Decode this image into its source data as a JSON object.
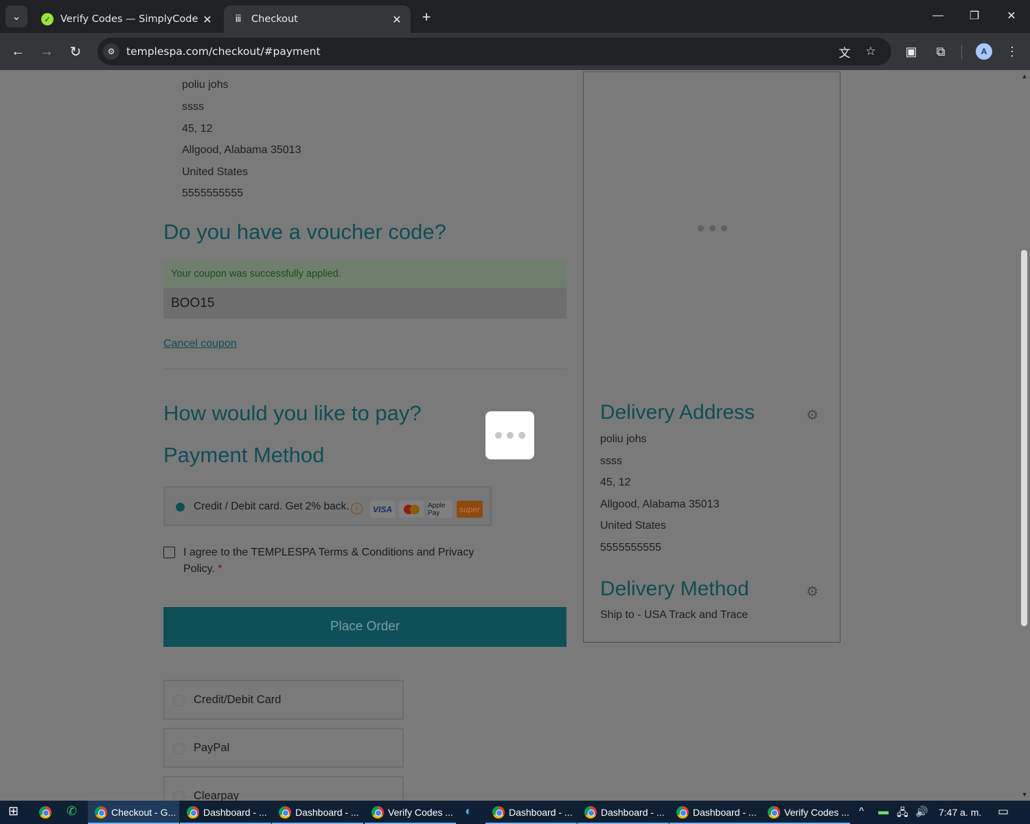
{
  "browser": {
    "tabs": [
      {
        "label": "Verify Codes — SimplyCodes",
        "active": false,
        "icon": "simplycodes-icon"
      },
      {
        "label": "Checkout",
        "active": true,
        "icon": "templespa-icon"
      }
    ],
    "url": "templespa.com/checkout/#payment",
    "profile_initial": "A"
  },
  "billing_address": [
    "poliu johs",
    "ssss",
    "45, 12",
    "Allgood, Alabama 35013",
    "United States",
    "5555555555"
  ],
  "voucher": {
    "heading": "Do you have a voucher code?",
    "success_message": "Your coupon was successfully applied.",
    "code_value": "BOO15",
    "cancel_link": "Cancel coupon"
  },
  "payment": {
    "heading": "How would you like to pay?",
    "method_heading": "Payment Method",
    "selected_option": "Credit / Debit card. Get 2% back.",
    "card_logos": [
      "VISA",
      "mastercard",
      "Apple Pay",
      "super"
    ],
    "terms_text": "I agree to the TEMPLESPA Terms & Conditions and Privacy Policy.",
    "terms_required_mark": "*",
    "place_order": "Place Order",
    "alternative_options": [
      "Credit/Debit Card",
      "PayPal",
      "Clearpay"
    ]
  },
  "sidebar": {
    "delivery_address_heading": "Delivery Address",
    "delivery_address": [
      "poliu johs",
      "ssss",
      "45, 12",
      "Allgood, Alabama 35013",
      "United States",
      "5555555555"
    ],
    "delivery_method_heading": "Delivery Method",
    "delivery_method": "Ship to - USA Track and Trace"
  },
  "taskbar": {
    "apps": [
      "Checkout - G...",
      "Dashboard - ...",
      "Dashboard - ...",
      "Verify Codes ...",
      "Dashboard - ...",
      "Dashboard - ...",
      "Dashboard - ...",
      "Verify Codes ..."
    ],
    "time": "7:47 a. m."
  },
  "colors": {
    "accent": "#0e4e56",
    "overlay_grey": "#7a7a7a",
    "success_text": "#1c4d17"
  }
}
